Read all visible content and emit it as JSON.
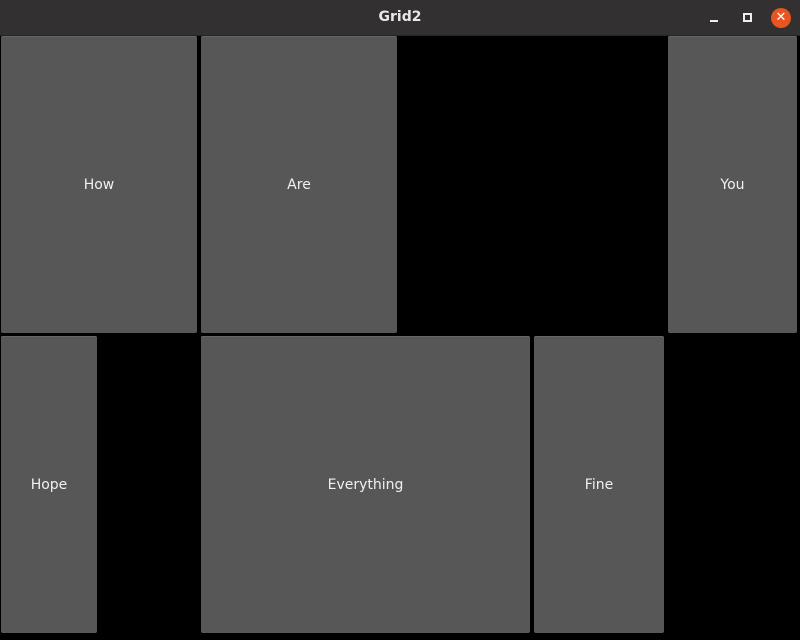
{
  "window": {
    "title": "Grid2",
    "close_color": "#e95420"
  },
  "buttons": {
    "how": "How",
    "are": "Are",
    "you": "You",
    "hope": "Hope",
    "everything": "Everything",
    "fine": "Fine"
  }
}
